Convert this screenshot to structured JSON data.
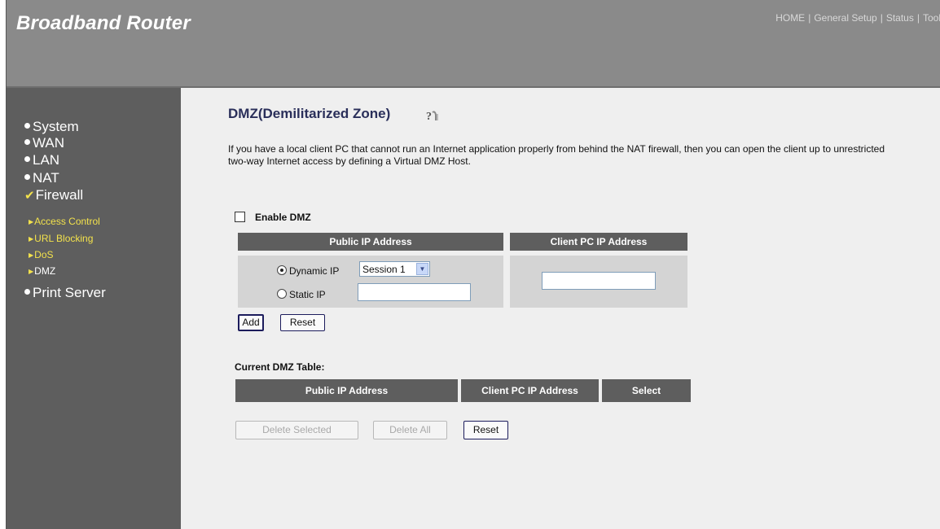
{
  "header": {
    "brand": "Broadband Router",
    "nav": [
      "HOME",
      "General Setup",
      "Status",
      "Tool"
    ]
  },
  "sidebar": {
    "items": [
      {
        "label": "System",
        "marker": "bullet"
      },
      {
        "label": "WAN",
        "marker": "bullet"
      },
      {
        "label": "LAN",
        "marker": "bullet"
      },
      {
        "label": "NAT",
        "marker": "bullet"
      },
      {
        "label": "Firewall",
        "marker": "check"
      },
      {
        "label": "Print Server",
        "marker": "bullet"
      }
    ],
    "firewall_sub": [
      {
        "label": "Access Control"
      },
      {
        "label": "URL Blocking"
      },
      {
        "label": "DoS"
      },
      {
        "label": "DMZ",
        "active": true
      }
    ]
  },
  "main": {
    "title": "DMZ(Demilitarized Zone)",
    "description": "If you have a local client PC that cannot run an Internet application properly from behind the NAT firewall, then you can open the client up to unrestricted two-way Internet access by defining a Virtual DMZ Host.",
    "enable_label": "Enable DMZ",
    "enable_checked": false,
    "form": {
      "col_public": "Public IP Address",
      "col_client": "Client PC IP Address",
      "dynamic_label": "Dynamic IP",
      "dynamic_selected": true,
      "session_value": "Session 1",
      "static_label": "Static IP",
      "static_ip_value": "",
      "client_ip_value": ""
    },
    "buttons": {
      "add": "Add",
      "reset": "Reset"
    },
    "current_table": {
      "label": "Current DMZ Table:",
      "headers": [
        "Public IP Address",
        "Client PC IP Address",
        "Select"
      ],
      "rows": []
    },
    "bottom_buttons": {
      "delete_selected": "Delete Selected",
      "delete_all": "Delete All",
      "reset": "Reset"
    }
  },
  "colors": {
    "header_bg": "#8a8a8a",
    "sidebar_bg": "#5e5e5e",
    "content_bg": "#efefef",
    "submenu_yellow": "#f3e24c",
    "title_color": "#2a2f5a"
  }
}
